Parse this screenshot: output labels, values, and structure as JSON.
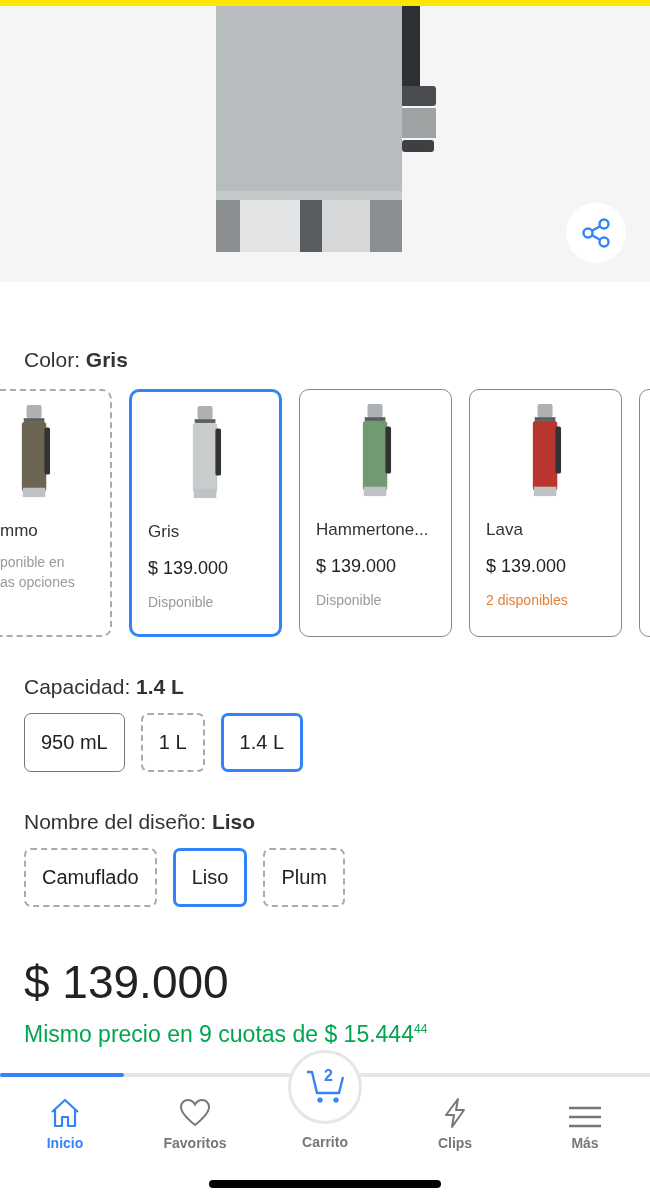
{
  "color_selector": {
    "label": "Color: ",
    "value": "Gris",
    "options": [
      {
        "name": "mmo",
        "availability": "ponible en\nas opciones",
        "kind": "unavailable",
        "selected": false
      },
      {
        "name": "Gris",
        "price": "$ 139.000",
        "availability": "Disponible",
        "kind": "available",
        "selected": true
      },
      {
        "name": "Hammertone...",
        "price": "$ 139.000",
        "availability": "Disponible",
        "kind": "available",
        "selected": false
      },
      {
        "name": "Lava",
        "price": "$ 139.000",
        "availability": "2 disponibles",
        "kind": "low_stock",
        "selected": false
      }
    ]
  },
  "capacity_selector": {
    "label": "Capacidad: ",
    "value": "1.4 L",
    "options": [
      {
        "label": "950 mL",
        "kind": "available",
        "selected": false
      },
      {
        "label": "1 L",
        "kind": "unavailable",
        "selected": false
      },
      {
        "label": "1.4 L",
        "kind": "available",
        "selected": true
      }
    ]
  },
  "design_selector": {
    "label": "Nombre del diseño: ",
    "value": "Liso",
    "options": [
      {
        "label": "Camuflado",
        "kind": "unavailable",
        "selected": false
      },
      {
        "label": "Liso",
        "kind": "available",
        "selected": true
      },
      {
        "label": "Plum",
        "kind": "unavailable",
        "selected": false
      }
    ]
  },
  "price": "$ 139.000",
  "installments": "Mismo precio en 9 cuotas de $ 15.444$^{44}$",
  "scroll_progress": {
    "level": 0.19
  },
  "bottom_nav": [
    {
      "label": "Inicio",
      "selected": true
    },
    {
      "label": "Favoritos",
      "selected": false
    },
    {
      "label": "Carrito",
      "badge": "2",
      "selected": false
    },
    {
      "label": "Clips",
      "selected": false
    },
    {
      "label": "Más",
      "selected": false
    }
  ]
}
